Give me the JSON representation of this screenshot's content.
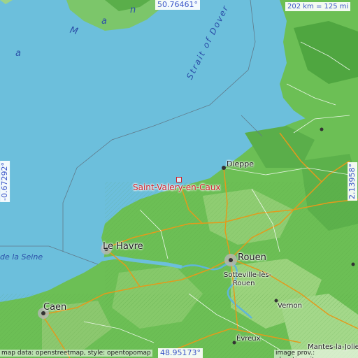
{
  "map": {
    "coords": {
      "north": "50.76461°",
      "south": "48.95173°",
      "west": "-0.67292°",
      "east": "2.13958°"
    },
    "scale": "202 km = 125 mi",
    "sea": {
      "mancheletters": [
        "a",
        "M",
        "a",
        "n"
      ],
      "strait": "Strait of Dover",
      "seine_bay": "de la Seine"
    },
    "main_place": "Saint-Valery-en-Caux",
    "cities": {
      "dieppe": "Dieppe",
      "lehavre": "Le Havre",
      "rouen": "Rouen",
      "sotteville": "Sotteville-lès-",
      "sotteville2": "Rouen",
      "caen": "Caen",
      "vernon": "Vernon",
      "evreux": "Évreux",
      "mantes": "Mantes-la-Jolie"
    },
    "attribution": {
      "left": "map data: openstreetmap, style: opentopomap",
      "right": "image prov.: elevation.city"
    },
    "colors": {
      "sea": "#6cbfdc",
      "land": "#6fbf56",
      "land_light": "#a9d98a",
      "road": "#e39a1c",
      "marker": "#d0202a"
    }
  }
}
